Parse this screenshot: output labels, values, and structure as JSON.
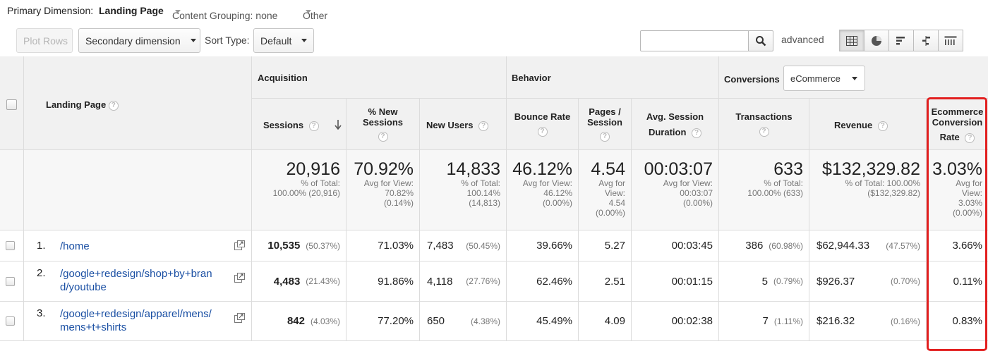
{
  "dimension_bar": {
    "label": "Primary Dimension:",
    "active": "Landing Page",
    "content_grouping": "Content Grouping: none",
    "other": "Other"
  },
  "toolbar": {
    "plot_rows": "Plot Rows",
    "secondary_dimension": "Secondary dimension",
    "sort_type_label": "Sort Type:",
    "sort_type_value": "Default",
    "search_value": "",
    "advanced": "advanced",
    "views": [
      "grid-icon",
      "pie-icon",
      "performance-bars-icon",
      "comparison-icon",
      "pivot-icon"
    ]
  },
  "table": {
    "landing_page_header": "Landing Page",
    "help": "?",
    "groups": {
      "acquisition": "Acquisition",
      "behavior": "Behavior",
      "conversions": "Conversions",
      "conversions_select": "eCommerce"
    },
    "columns": {
      "sessions": "Sessions",
      "new_sessions_1": "% New",
      "new_sessions_2": "Sessions",
      "new_users": "New Users",
      "bounce_rate": "Bounce Rate",
      "pages_session_1": "Pages /",
      "pages_session_2": "Session",
      "avg_duration_1": "Avg. Session",
      "avg_duration_2": "Duration",
      "transactions": "Transactions",
      "revenue": "Revenue",
      "ecr_1": "Ecommerce",
      "ecr_2": "Conversion",
      "ecr_3": "Rate"
    },
    "totals": {
      "sessions": {
        "big": "20,916",
        "l1": "% of Total:",
        "l2": "100.00% (20,916)"
      },
      "new_sessions": {
        "big": "70.92%",
        "l1": "Avg for View:",
        "l2": "70.82%",
        "l3": "(0.14%)"
      },
      "new_users": {
        "big": "14,833",
        "l1": "% of Total:",
        "l2": "100.14%",
        "l3": "(14,813)"
      },
      "bounce_rate": {
        "big": "46.12%",
        "l1": "Avg for View:",
        "l2": "46.12%",
        "l3": "(0.00%)"
      },
      "pages_session": {
        "big": "4.54",
        "l1": "Avg for",
        "l2": "View:",
        "l3": "4.54",
        "l4": "(0.00%)"
      },
      "avg_duration": {
        "big": "00:03:07",
        "l1": "Avg for View:",
        "l2": "00:03:07",
        "l3": "(0.00%)"
      },
      "transactions": {
        "big": "633",
        "l1": "% of Total:",
        "l2": "100.00% (633)"
      },
      "revenue": {
        "big": "$132,329.82",
        "l1": "% of Total: 100.00%",
        "l2": "($132,329.82)"
      },
      "ecr": {
        "big": "3.03%",
        "l1": "Avg for",
        "l2": "View:",
        "l3": "3.03%",
        "l4": "(0.00%)"
      }
    },
    "rows": [
      {
        "num": "1.",
        "page": "/home",
        "page2": "",
        "sessions": "10,535",
        "sessions_pct": "(50.37%)",
        "new_sessions": "71.03%",
        "new_users": "7,483",
        "new_users_pct": "(50.45%)",
        "bounce": "39.66%",
        "pages": "5.27",
        "duration": "00:03:45",
        "transactions": "386",
        "transactions_pct": "(60.98%)",
        "revenue": "$62,944.33",
        "revenue_pct": "(47.57%)",
        "ecr": "3.66%"
      },
      {
        "num": "2.",
        "page": "/google+redesign/shop+by+bran",
        "page2": "d/youtube",
        "sessions": "4,483",
        "sessions_pct": "(21.43%)",
        "new_sessions": "91.86%",
        "new_users": "4,118",
        "new_users_pct": "(27.76%)",
        "bounce": "62.46%",
        "pages": "2.51",
        "duration": "00:01:15",
        "transactions": "5",
        "transactions_pct": "(0.79%)",
        "revenue": "$926.37",
        "revenue_pct": "(0.70%)",
        "ecr": "0.11%"
      },
      {
        "num": "3.",
        "page": "/google+redesign/apparel/mens/",
        "page2": "mens+t+shirts",
        "sessions": "842",
        "sessions_pct": "(4.03%)",
        "new_sessions": "77.20%",
        "new_users": "650",
        "new_users_pct": "(4.38%)",
        "bounce": "45.49%",
        "pages": "4.09",
        "duration": "00:02:38",
        "transactions": "7",
        "transactions_pct": "(1.11%)",
        "revenue": "$216.32",
        "revenue_pct": "(0.16%)",
        "ecr": "0.83%"
      }
    ]
  },
  "colors": {
    "highlight": "#e21f1f",
    "link": "#1a4fa3",
    "header_bg": "#f1f1f1"
  }
}
